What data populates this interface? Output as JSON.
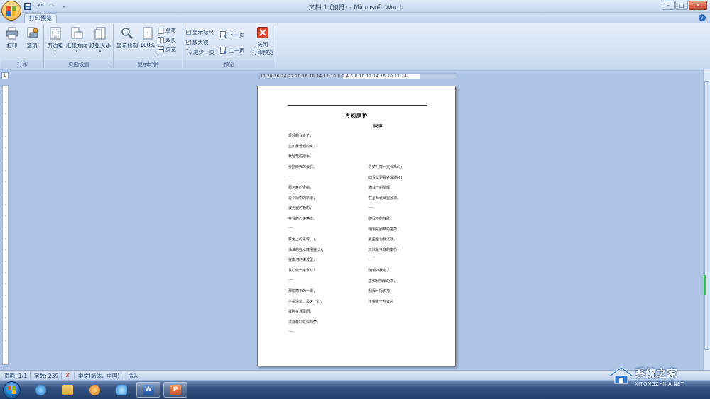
{
  "window": {
    "title": "文档 1 (预览) - Microsoft Word"
  },
  "quick_access": {
    "save_icon": "save-icon",
    "undo_icon": "undo-icon",
    "redo_icon": "redo-icon"
  },
  "tabs": [
    {
      "label": "打印预览"
    }
  ],
  "ribbon": {
    "print_group": {
      "label": "打印",
      "print_button": "打印",
      "options_button": "选项"
    },
    "page_setup_group": {
      "label": "页面设置",
      "margins_button": "页边距",
      "orientation_button": "纸张方向",
      "size_button": "纸张大小"
    },
    "zoom_group": {
      "label": "显示比例",
      "zoom_button": "显示比例",
      "hundred_button": "100%",
      "one_page": "单页",
      "two_pages": "双页",
      "page_width": "页宽"
    },
    "preview_group": {
      "label": "预览",
      "show_ruler": "显示标尺",
      "magnifier": "放大镜",
      "shrink_one_page": "减少一页",
      "next_page": "下一页",
      "prev_page": "上一页",
      "close_preview_line1": "关闭",
      "close_preview_line2": "打印预览"
    }
  },
  "ruler": {
    "ticks": "30 28 26 24 22 20 18 16 14 12 10  8       2   4   6   8  10  12  14     18  20  22  24"
  },
  "document": {
    "title": "再别康桥",
    "author": "徐志摩",
    "left_column": [
      "轻轻的我走了，",
      "正如我轻轻的来；",
      "我轻轻的招手，",
      "作别西天的云彩。",
      "----",
      "那河畔的金柳，",
      "是夕阳中的新娘；",
      "波光里的艳影，",
      "在我的心头荡漾。",
      "----",
      "软泥上的青荇(1)，",
      "油油的在水底招摇(2)；",
      "在康河的柔波里，",
      "甘心做一条水草！",
      "----",
      "那榆荫下的一潭，",
      "不是清泉，是天上虹；",
      "揉碎在浮藻间，",
      "沉淀着彩虹似的梦。",
      "----"
    ],
    "right_column": [
      "寻梦？撑一支长篙(3)，",
      "向青草更青处漫溯(4)；",
      "满载一船星辉，",
      "在星辉斑斓里放歌。",
      "----",
      "但我不能放歌，",
      "悄悄是别离的笙箫；",
      "夏虫也为我沉默，",
      "沉默是今晚的康桥！",
      "----",
      "悄悄的我走了，",
      "正如我悄悄的来；",
      "我挥一挥衣袖，",
      "不带走一片云彩"
    ]
  },
  "status_bar": {
    "page": "页面: 1/1",
    "words": "字数: 239",
    "language": "中文(简体，中国)",
    "mode": "插入"
  },
  "watermark": {
    "text": "系统之家",
    "url": "XITONGZHIJIA.NET"
  },
  "colors": {
    "ribbon_bg": "#d3e1f3",
    "workspace_bg": "#aec5e6",
    "close_red": "#c8462c",
    "taskbar": "#22406b"
  }
}
